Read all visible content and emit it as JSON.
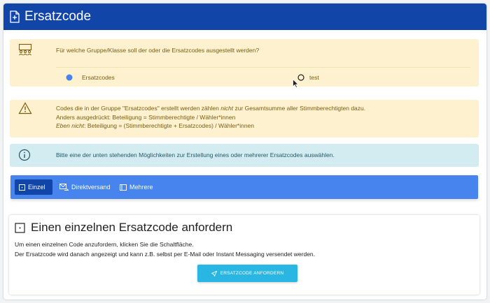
{
  "header": {
    "title": "Ersatzcode",
    "icon": "file-plus-icon"
  },
  "group_select": {
    "icon": "people-group-icon",
    "question": "Für welche Gruppe/Klasse soll der oder die Ersatzcodes ausgestellt werden?",
    "options": [
      {
        "label": "Ersatzcodes",
        "selected": true
      },
      {
        "label": "test",
        "selected": false
      }
    ]
  },
  "warning": {
    "icon": "warning-triangle-icon",
    "line1": "Codes die in der Gruppe \"Ersatzcodes\" erstellt werden zählen ",
    "line1_em": "nicht",
    "line1_end": " zur Gesamtsumme aller Stimmberechtigten dazu.",
    "line2": "Anders ausgedrückt: Beteiligung = Stimmberechtigte / Wähler*innen",
    "line3_em": "Eben nicht",
    "line3": ": Beteiligung = (Stimmberechtigte + Ersatzcodes) / Wähler*innen"
  },
  "info": {
    "icon": "info-circle-icon",
    "text": "Bitte eine der unten stehenden Möglichkeiten zur Erstellung eines oder mehrerer Ersatzcodes auswählen."
  },
  "tabs": [
    {
      "label": "Einzel",
      "active": true,
      "icon": "square-icon"
    },
    {
      "label": "Direktversand",
      "active": false,
      "icon": "send-mail-icon"
    },
    {
      "label": "Mehrere",
      "active": false,
      "icon": "stack-icon"
    }
  ],
  "section": {
    "title": "Einen einzelnen Ersatzcode anfordern",
    "line1": "Um einen einzelnen Code anzufordern, klicken Sie die Schaltfläche.",
    "line2": "Der Ersatzcode wird danach angezeigt und kann z.B. selbst per E-Mail oder Instant Messaging versendet werden.",
    "button": "ERSATZCODE ANFORDERN"
  },
  "colors": {
    "header_bg": "#1145a8",
    "warning_bg": "#fdf1cf",
    "info_bg": "#d3ecf1",
    "tabbar_bg": "#4784ed",
    "button_bg": "#29b6e3"
  }
}
